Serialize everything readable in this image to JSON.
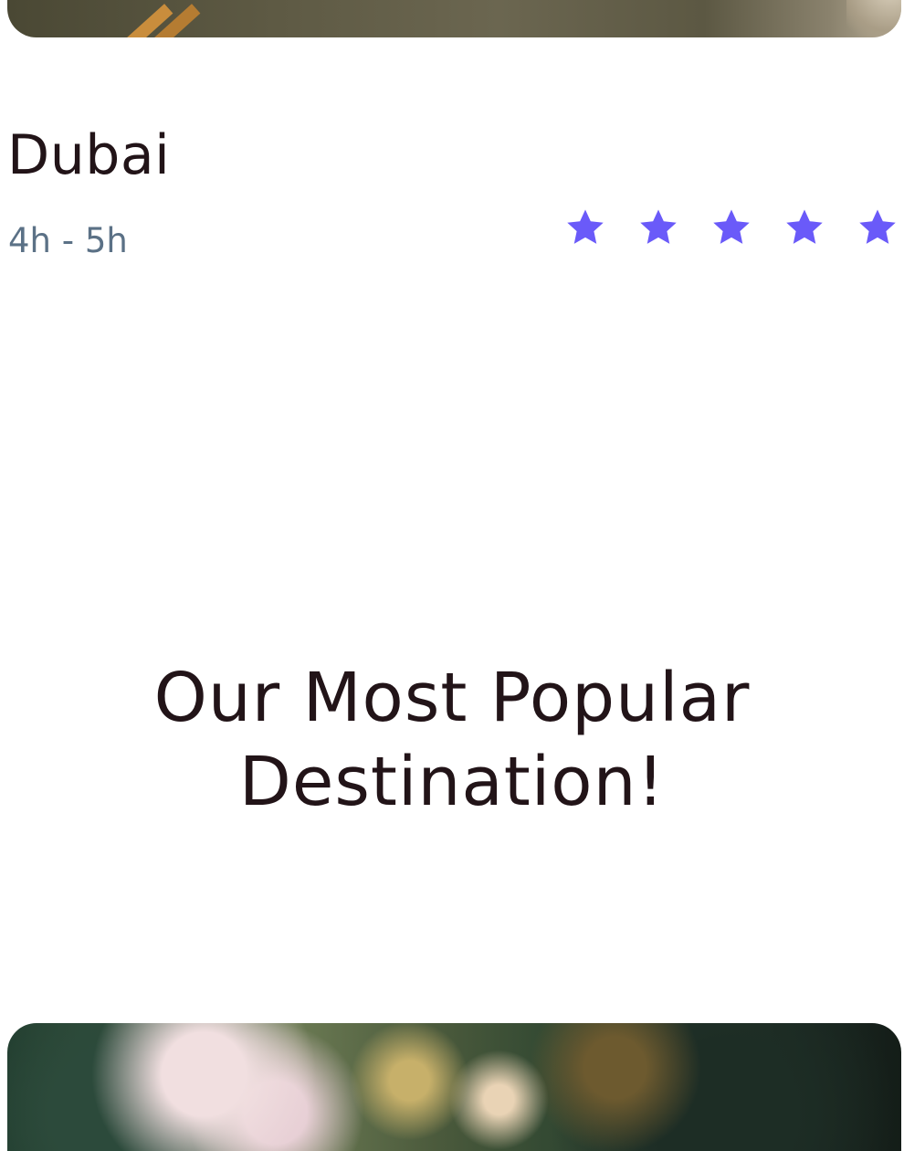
{
  "destination": {
    "name": "Dubai",
    "duration": "4h - 5h",
    "rating": 5,
    "rating_max": 5,
    "star_color": "#6a5af9"
  },
  "section": {
    "title_line1": "Our Most Popular",
    "title_line2": "Destination!"
  },
  "colors": {
    "heading": "#221418",
    "muted": "#5b7186",
    "background": "#ffffff"
  }
}
